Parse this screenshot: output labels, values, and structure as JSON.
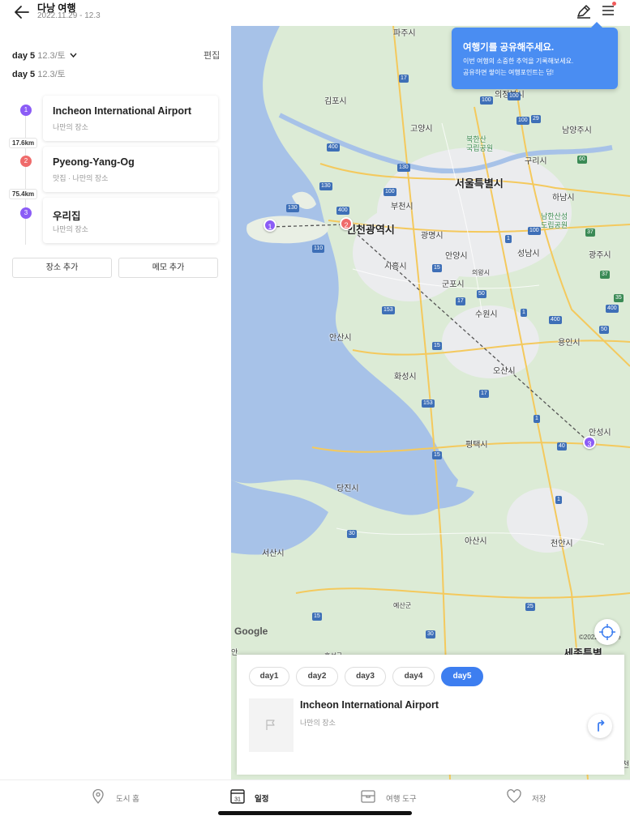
{
  "header": {
    "title": "다낭 여행",
    "dates": "2022.11.29 - 12.3",
    "icons": [
      "back-arrow-icon",
      "edit-pen-icon",
      "hamburger-menu-icon"
    ]
  },
  "schedule": {
    "day_selector": {
      "day": "day 5",
      "date": "12.3/토"
    },
    "day_title": {
      "day": "day 5",
      "date": "12.3/토"
    },
    "edit_label": "편집",
    "places": [
      {
        "number": "1",
        "name": "Incheon International Airport",
        "sub": "나만의 장소",
        "color": "#8b5cf6"
      },
      {
        "number": "2",
        "name": "Pyeong-Yang-Og",
        "sub": "맛집 · 나만의 장소",
        "color": "#ef6b6b"
      },
      {
        "number": "3",
        "name": "우리집",
        "sub": "나만의 장소",
        "color": "#8b5cf6"
      }
    ],
    "distances": [
      "17.6km",
      "75.4km"
    ],
    "add_place": "장소 추가",
    "add_memo": "메모 추가"
  },
  "map": {
    "tooltip": {
      "title": "여행기를 공유해주세요.",
      "line1": "이번 여행의 소중한 추억을 기록해보세요.",
      "line2": "공유하면 쌓이는 여행포인트는 덤!"
    },
    "labels": {
      "paju": "파주시",
      "gimpo": "김포시",
      "goyang": "고양시",
      "uijeongbu": "의정부시",
      "namyangju": "남양주시",
      "guri": "구리시",
      "bukhansan": "북한산",
      "bukhansan2": "국립공원",
      "seoul": "서울특별시",
      "hanam": "하남시",
      "bucheon": "부천시",
      "incheon": "인천광역시",
      "gwangmyeong": "광명시",
      "anyang": "안양시",
      "seongnam": "성남시",
      "gwangju": "광주시",
      "namhansanseong": "남한산성",
      "namhansanseong2": "도립공원",
      "siheung": "시흥시",
      "gunpo": "군포시",
      "uiwang": "의왕시",
      "suwon": "수원시",
      "ansan": "안산시",
      "yongin": "용인시",
      "hwaseong": "화성시",
      "osan": "오산시",
      "anseong": "안성시",
      "pyeongtaek": "평택시",
      "dangjin": "당진시",
      "asan": "아산시",
      "cheonan": "천안시",
      "seosan": "서산시",
      "yesan": "예산군",
      "hongseong": "홍성군",
      "sejong": "세종특별",
      "an": "안",
      "cheon": "천"
    },
    "google": "Google",
    "copyright": "©2022 Google",
    "pins": [
      "1",
      "2",
      "3"
    ]
  },
  "bottom_panel": {
    "days": [
      "day1",
      "day2",
      "day3",
      "day4",
      "day5"
    ],
    "active_day": "day5",
    "place_name": "Incheon International Airport",
    "place_sub": "나만의 장소"
  },
  "tabbar": {
    "items": [
      {
        "label": "도시 홈",
        "icon": "map-pin-icon"
      },
      {
        "label": "일정",
        "icon": "calendar-icon",
        "badge": "31"
      },
      {
        "label": "여행 도구",
        "icon": "toolbox-icon"
      },
      {
        "label": "저장",
        "icon": "heart-icon"
      }
    ],
    "active": "일정"
  }
}
